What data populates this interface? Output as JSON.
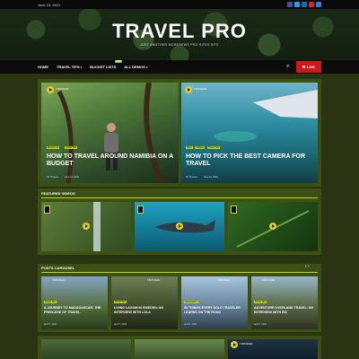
{
  "topbar": {
    "date": "June 13, 2021"
  },
  "brand": {
    "title": "TRAVEL PRO",
    "tagline": "JUST ANOTHER MORENEWS PRO SITES SITE"
  },
  "nav": {
    "items": [
      "HOME",
      "TRAVEL TIPS",
      "BUCKET LISTS",
      "ALL DEMOS"
    ],
    "hot": "NEW",
    "live": "LIVE"
  },
  "hero": {
    "left": {
      "label": "5 MIN READ",
      "tags": [
        "Bucket List",
        "Travel Tips"
      ],
      "title": "HOW TO TRAVEL AROUND NAMIBIA ON A BUDGET",
      "author": "AF Themes",
      "date": "June 12, 2021"
    },
    "right": {
      "label": "5 MIN READ",
      "tags": [
        "Style",
        "Gadgets",
        "Travel Tips"
      ],
      "title": "HOW TO PICK THE BEST CAMERA FOR TRAVEL",
      "author": "AF Themes",
      "date": "June 12, 2021"
    }
  },
  "featured": {
    "title": "FEATURED VIDEOS"
  },
  "carousel": {
    "title": "POSTS CAROUSEL",
    "items": [
      {
        "label": "3 MIN READ",
        "tag": "Travel Tips",
        "title": "A JOURNEY TO MADAGASCAR: THE PRIVILEGE OF TRAVEL",
        "date": "April 7, 2016"
      },
      {
        "label": "3 MIN READ",
        "tag": "Travel Tips",
        "title": "LIVING LAGOM IN SWEDEN: AN INTERVIEW WITH LOLA",
        "date": "April 7, 2016"
      },
      {
        "label": "3 MIN READ",
        "tag": "Destinations",
        "title": "56 THINGS EVERY SOLO TRAVELER LEARNS ON THE ROAD",
        "date": "April 7, 2016"
      },
      {
        "label": "3 MIN READ",
        "tag": "Travel Tips",
        "title": "ADVENTURE OVERLAND TRAVEL: AN INTERVIEW WITH RIC",
        "date": "April 7, 2016"
      }
    ]
  },
  "bottom": {
    "label": "5 MIN READ"
  },
  "colors": {
    "accent": "#c9d400",
    "live": "#d01818",
    "panel": "#3d5014"
  }
}
